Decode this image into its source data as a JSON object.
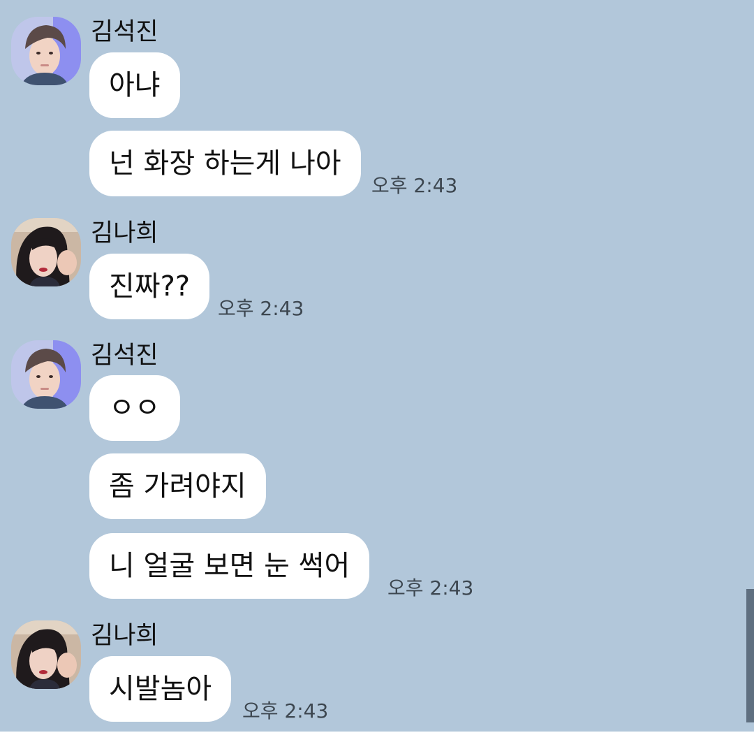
{
  "messages": [
    {
      "sender": "김석진",
      "bubbles": [
        "아냐",
        "넌 화장 하는게 나아"
      ],
      "time": "오후 2:43"
    },
    {
      "sender": "김나희",
      "bubbles": [
        "진짜??"
      ],
      "time": "오후 2:43"
    },
    {
      "sender": "김석진",
      "bubbles": [
        "ㅇㅇ",
        "좀 가려야지",
        "니 얼굴 보면 눈 썩어"
      ],
      "time": "오후 2:43"
    },
    {
      "sender": "김나희",
      "bubbles": [
        "시발놈아"
      ],
      "time": "오후 2:43"
    }
  ],
  "colors": {
    "chat_background": "#b2c7da",
    "bubble": "#ffffff",
    "timestamp_text": "#3d4750",
    "scrollbar": "#5f6f80"
  },
  "icons": {
    "jin_avatar": "avatar-photo-man",
    "nahee_avatar": "avatar-photo-woman"
  }
}
